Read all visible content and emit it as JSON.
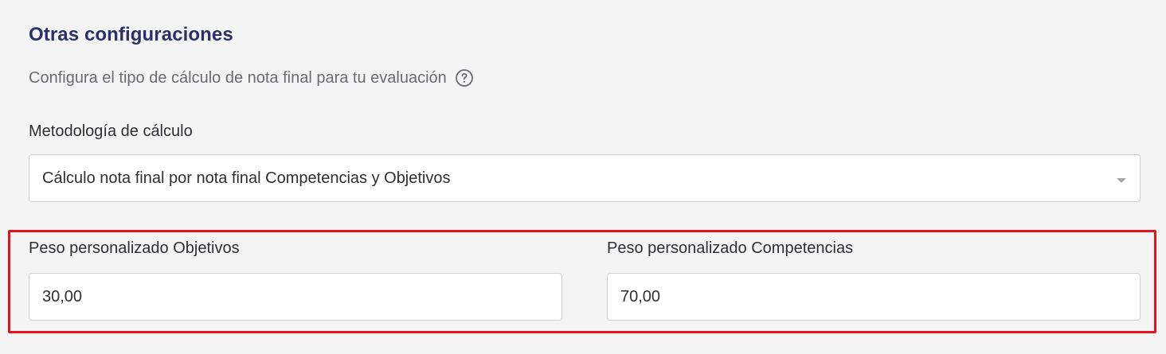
{
  "section": {
    "title": "Otras configuraciones",
    "subtitle": "Configura el tipo de cálculo de nota final para tu evaluación",
    "help_icon": "question-circle-icon"
  },
  "method": {
    "label": "Metodología de cálculo",
    "selected_value": "Cálculo nota final por nota final Competencias y Objetivos",
    "dropdown_icon": "chevron-down-icon"
  },
  "weights": {
    "objectives": {
      "label": "Peso personalizado Objetivos",
      "value": "30,00"
    },
    "competencies": {
      "label": "Peso personalizado Competencias",
      "value": "70,00"
    }
  },
  "colors": {
    "title": "#2b2f6a",
    "highlight_border": "#e0141a",
    "background": "#f4f4f5"
  }
}
